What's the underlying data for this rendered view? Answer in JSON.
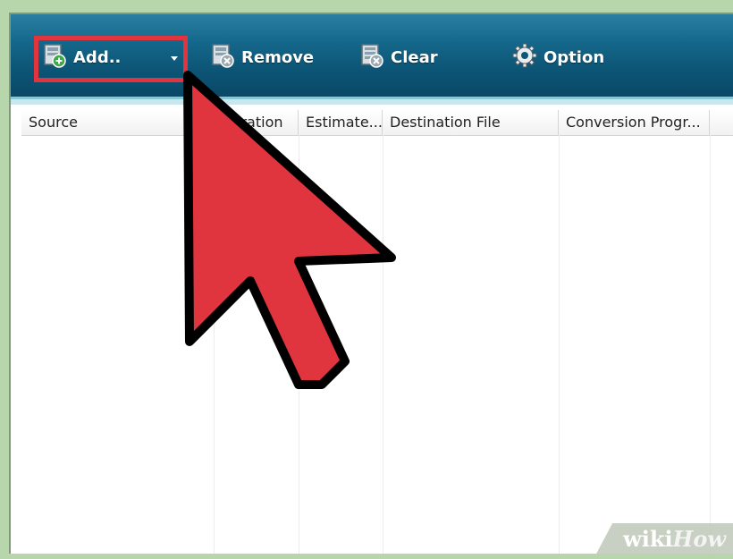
{
  "toolbar": {
    "add_label": "Add..",
    "remove_label": "Remove",
    "clear_label": "Clear",
    "option_label": "Option"
  },
  "table": {
    "columns": [
      "Source",
      "Duration",
      "Estimate...",
      "Destination File",
      "Conversion Progr..."
    ]
  },
  "watermark": {
    "wiki": "wiki",
    "how": "How"
  },
  "colors": {
    "toolbar": "#0d5677",
    "highlight": "#e0353f",
    "cursor": "#e0353f"
  }
}
